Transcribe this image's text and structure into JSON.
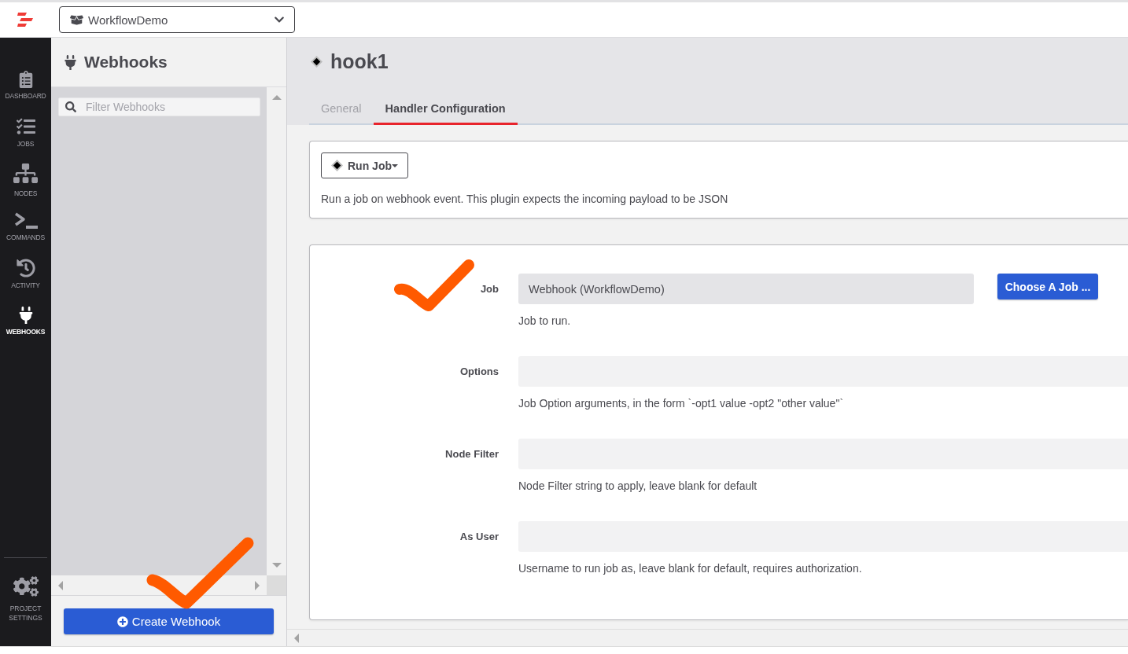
{
  "top_bar": {
    "project_select": {
      "value": "WorkflowDemo"
    }
  },
  "nav": {
    "items": [
      {
        "label": "DASHBOARD",
        "selected": false
      },
      {
        "label": "JOBS",
        "selected": false
      },
      {
        "label": "NODES",
        "selected": false
      },
      {
        "label": "COMMANDS",
        "selected": false
      },
      {
        "label": "ACTIVITY",
        "selected": false
      },
      {
        "label": "WEBHOOKS",
        "selected": true
      }
    ],
    "settings": {
      "label": "PROJECT SETTINGS"
    }
  },
  "webhooks_panel": {
    "title": "Webhooks",
    "filter": {
      "placeholder": "Filter Webhooks"
    },
    "create_button": "Create Webhook"
  },
  "webhook": {
    "title": "hook1",
    "tabs": [
      {
        "label": "General",
        "selected": false
      },
      {
        "label": "Handler Configuration",
        "selected": true
      }
    ],
    "handler": {
      "plugin_button": "Run Job",
      "description": "Run a job on webhook event. This plugin expects the incoming payload to be JSON"
    },
    "fields": [
      {
        "label": "Job",
        "value": "Webhook (WorkflowDemo)",
        "readonly": true,
        "button": "Choose A Job ...",
        "help": "Job to run."
      },
      {
        "label": "Options",
        "readonly": false,
        "help": "Job Option arguments, in the form `-opt1 value -opt2 \"other value\"`"
      },
      {
        "label": "Node Filter",
        "readonly": false,
        "help": "Node Filter string to apply, leave blank for default"
      },
      {
        "label": "As User",
        "readonly": false,
        "help": "Username to run job as, leave blank for default, requires authorization."
      }
    ]
  }
}
